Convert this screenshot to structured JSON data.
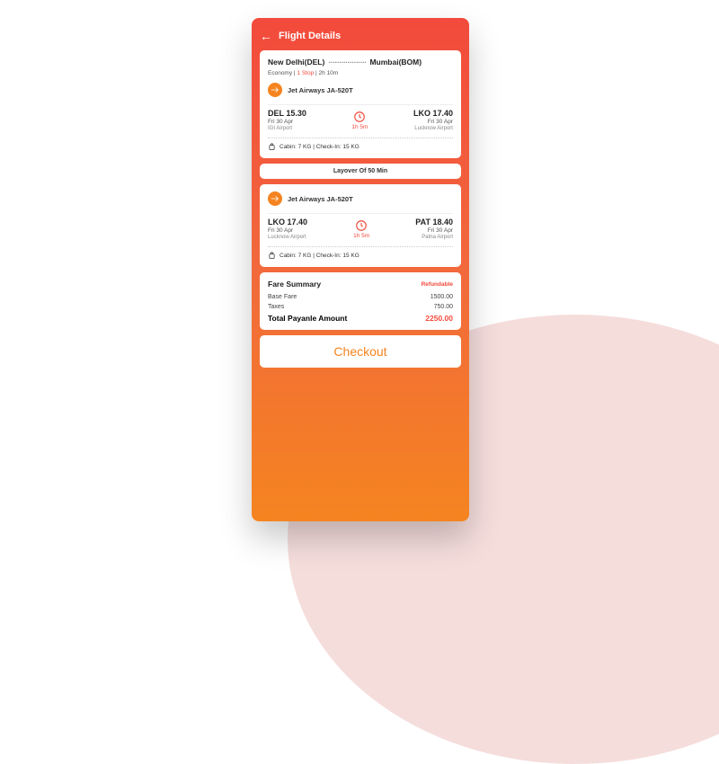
{
  "header": {
    "title": "Flight Details"
  },
  "route": {
    "from": "New Delhi(DEL)",
    "to": "Mumbai(BOM)"
  },
  "meta": {
    "class": "Economy",
    "stops": "1 Stop",
    "duration": "2h 10m"
  },
  "segments": [
    {
      "airline": "Jet Airways  JA-520T",
      "dep": {
        "code": "DEL 15.30",
        "date": "Fri 30 Apr",
        "airport": "IGI Airport"
      },
      "arr": {
        "code": "LKO 17.40",
        "date": "Fri 30 Apr",
        "airport": "Lucknow Airport"
      },
      "duration": "1h 5m",
      "baggage": "Cabin: 7 KG | Check-In: 15 KG"
    },
    {
      "airline": "Jet Airways  JA-520T",
      "dep": {
        "code": "LKO 17.40",
        "date": "Fri 30 Apr",
        "airport": "Lucknow Airport"
      },
      "arr": {
        "code": "PAT 18.40",
        "date": "Fri 30 Apr",
        "airport": "Patna Airport"
      },
      "duration": "1h 5m",
      "baggage": "Cabin: 7 KG | Check-In: 15 KG"
    }
  ],
  "layover": "Layover Of 50 Min",
  "fare": {
    "title": "Fare Summary",
    "refundable": "Refundable",
    "rows": [
      {
        "label": "Base Fare",
        "value": "1500.00"
      },
      {
        "label": "Taxes",
        "value": "750.00"
      }
    ],
    "totalLabel": "Total Payanle Amount",
    "totalValue": "2250.00"
  },
  "checkout": "Checkout"
}
